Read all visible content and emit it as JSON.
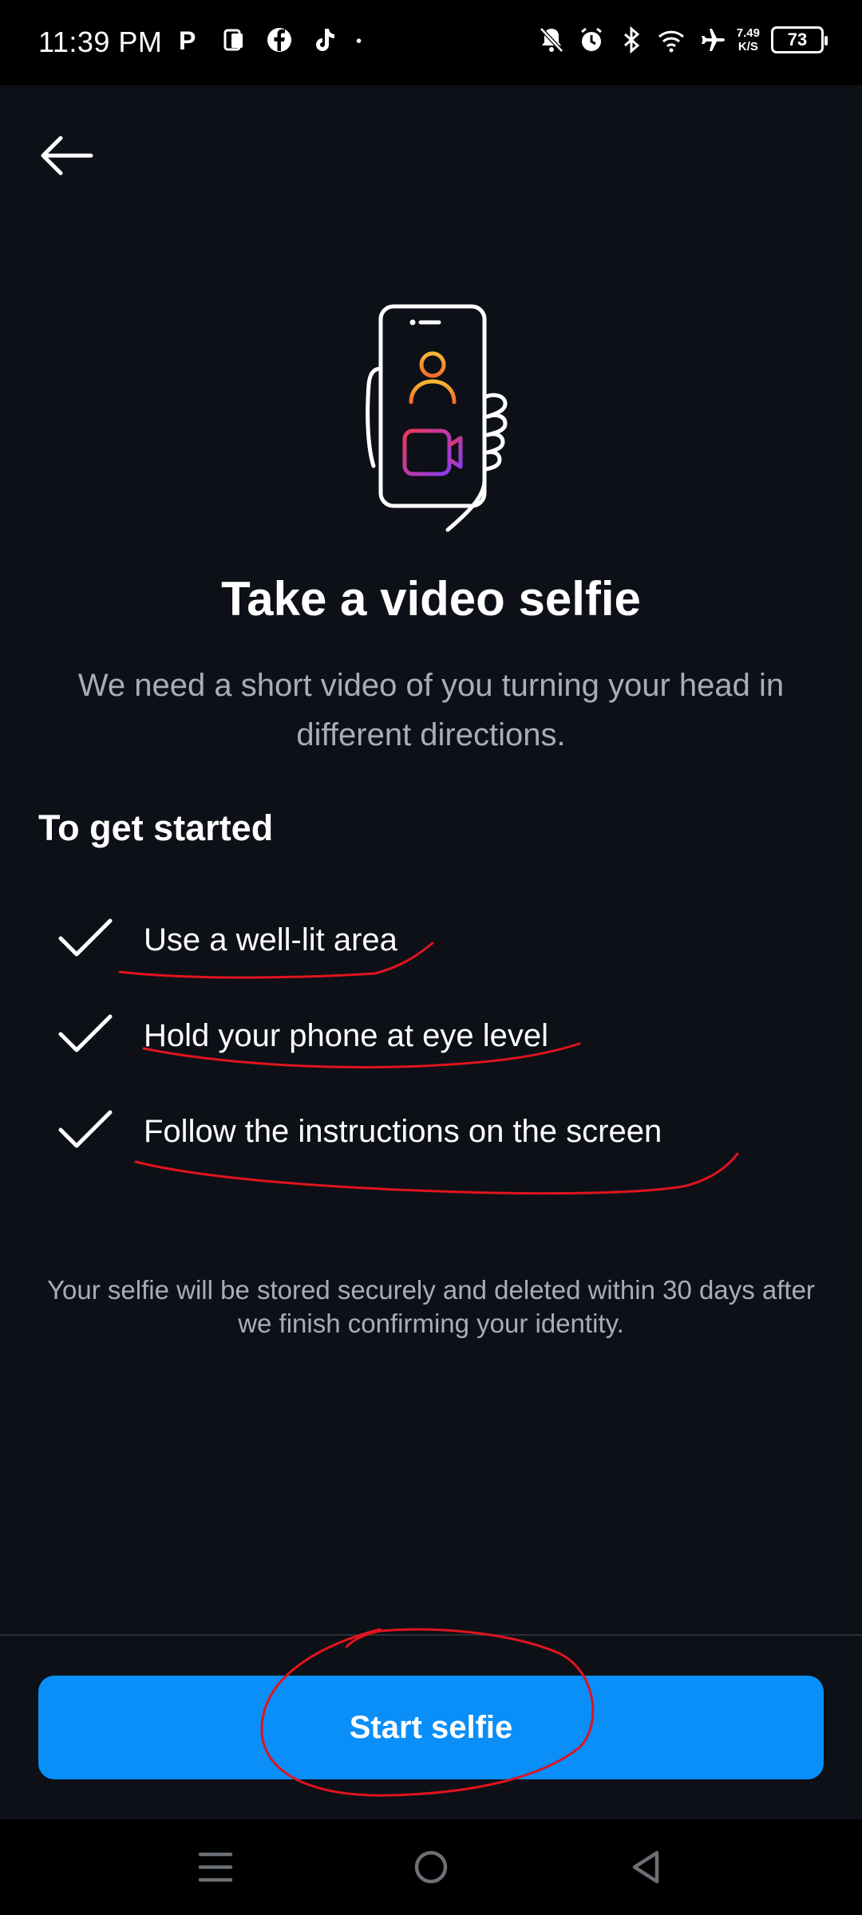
{
  "status_bar": {
    "time": "11:39 PM",
    "net_speed_value": "7.49",
    "net_speed_unit": "K/S",
    "battery_level": "73",
    "left_icons": [
      "parking-app-icon",
      "app-icon",
      "facebook-icon",
      "tiktok-icon",
      "dot-icon"
    ],
    "right_icons": [
      "bell-off-icon",
      "alarm-icon",
      "bluetooth-icon",
      "wifi-icon",
      "airplane-icon"
    ]
  },
  "header": {
    "back_icon": "arrow-left-icon"
  },
  "illustration": {
    "icon": "phone-video-selfie-icon"
  },
  "main": {
    "title": "Take a video selfie",
    "subtitle": "We need a short video of you turning your head in different directions.",
    "section_heading": "To get started",
    "checklist": [
      {
        "text": "Use a well-lit area"
      },
      {
        "text": "Hold your phone at eye level"
      },
      {
        "text": "Follow the instructions on the screen"
      }
    ],
    "disclaimer": "Your selfie will be stored securely and deleted within 30 days after we finish confirming your identity."
  },
  "footer": {
    "start_button_label": "Start selfie"
  },
  "nav_bar": {
    "icons": [
      "menu-icon",
      "home-icon",
      "back-triangle-icon"
    ]
  },
  "colors": {
    "background": "#0d1016",
    "accent": "#0a8ef8",
    "annotation": "#e0141e",
    "secondary_text": "#a8aeb8"
  }
}
